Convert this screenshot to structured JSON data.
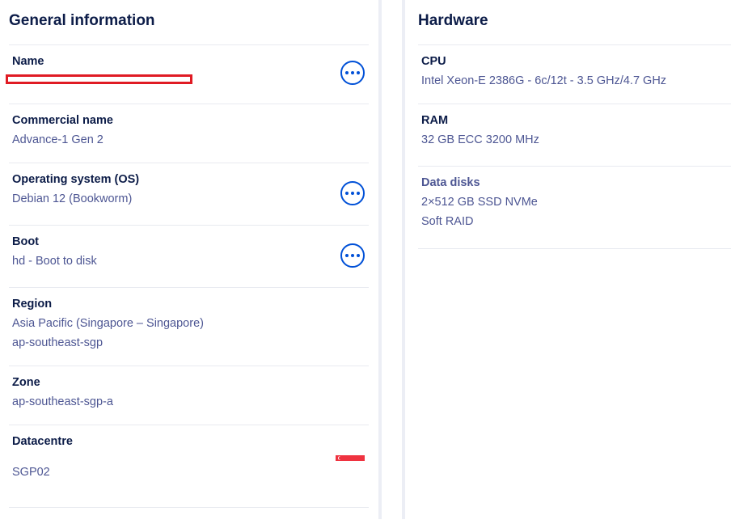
{
  "general": {
    "title": "General information",
    "name": {
      "label": "Name",
      "value": ""
    },
    "commercial_name": {
      "label": "Commercial name",
      "value": "Advance-1 Gen 2"
    },
    "os": {
      "label": "Operating system (OS)",
      "value": "Debian 12 (Bookworm)"
    },
    "boot": {
      "label": "Boot",
      "value": "hd - Boot to disk"
    },
    "region": {
      "label": "Region",
      "value_line1": "Asia Pacific (Singapore – Singapore)",
      "value_line2": "ap-southeast-sgp"
    },
    "zone": {
      "label": "Zone",
      "value": "ap-southeast-sgp-a"
    },
    "datacentre": {
      "label": "Datacentre",
      "value": "SGP02",
      "flag_icon": "singapore-flag-icon"
    }
  },
  "hardware": {
    "title": "Hardware",
    "cpu": {
      "label": "CPU",
      "value": "Intel Xeon-E 2386G - 6c/12t - 3.5 GHz/4.7 GHz"
    },
    "ram": {
      "label": "RAM",
      "value": "32 GB ECC 3200 MHz"
    },
    "data_disks": {
      "label": "Data disks",
      "value_line1": "2×512 GB SSD NVMe",
      "value_line2": "Soft RAID"
    }
  },
  "colors": {
    "heading": "#0c1c48",
    "value_text": "#4d5693",
    "action_blue": "#0050d7",
    "redaction_red": "#e01b24"
  }
}
